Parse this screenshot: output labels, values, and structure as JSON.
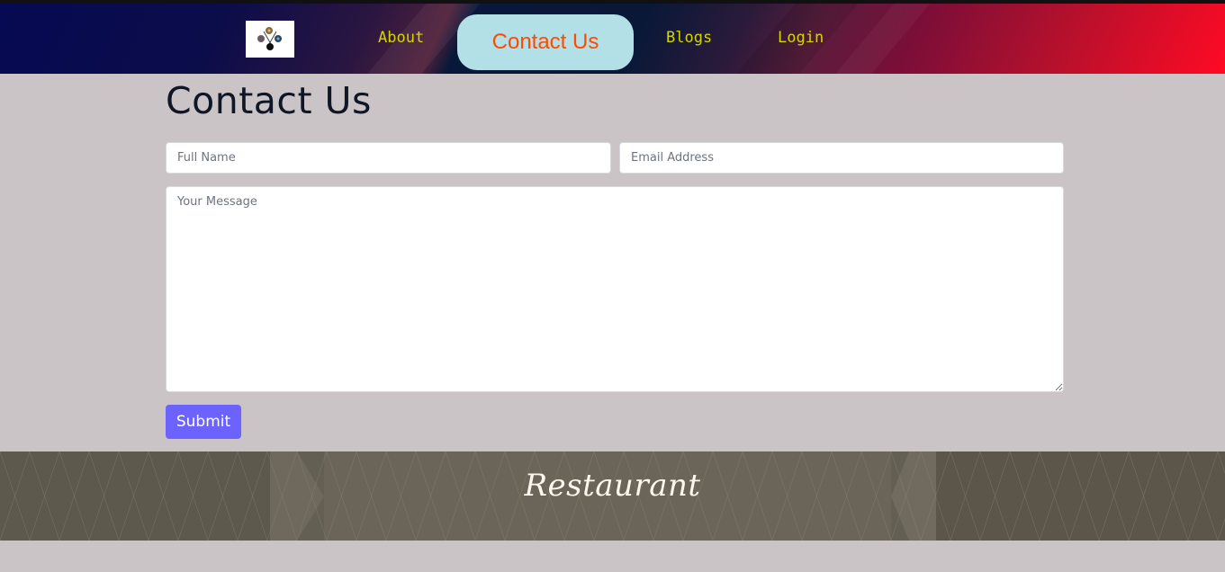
{
  "nav": {
    "items": [
      {
        "label": "About"
      },
      {
        "label": "Contact Us"
      },
      {
        "label": "Blogs"
      },
      {
        "label": "Login"
      }
    ],
    "link_color": "#d4d400",
    "active_bg": "#b2e0e6",
    "active_color": "#ff4a00"
  },
  "page": {
    "title": "Contact Us"
  },
  "form": {
    "fullname_placeholder": "Full Name",
    "email_placeholder": "Email Address",
    "message_placeholder": "Your Message",
    "submit_label": "Submit",
    "submit_color": "#6c63ff"
  },
  "footer": {
    "title": "Restaurant"
  },
  "colors": {
    "background": "#cac4c7",
    "footer_bg": "#645f53"
  }
}
